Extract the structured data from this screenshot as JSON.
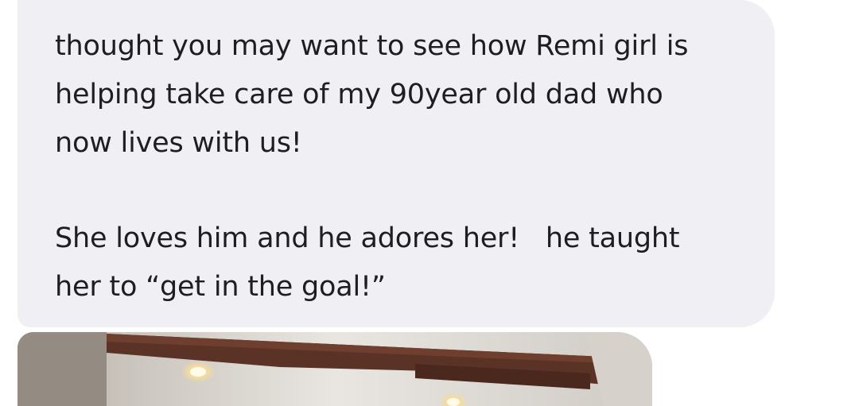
{
  "message": {
    "paragraph1": [
      "thought you may want to see how Remi girl is",
      "helping take care of my 90year old dad who",
      "now lives with us!"
    ],
    "paragraph2": [
      "She loves him and he adores her!   he taught",
      "her to “get in the goal!”"
    ]
  },
  "colors": {
    "bubble_bg": "#f0eff4",
    "text": "#1e1e22"
  }
}
